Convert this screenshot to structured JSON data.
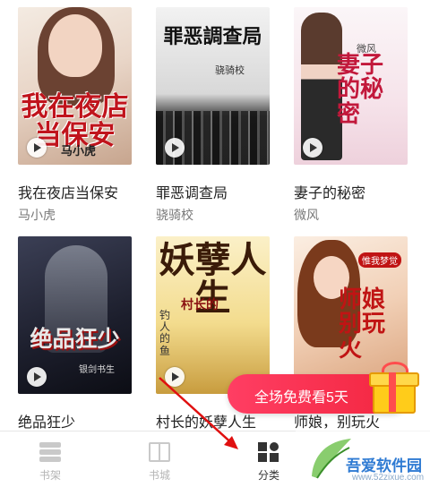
{
  "books": [
    {
      "title": "我在夜店当保安",
      "author": "马小虎",
      "cover_text": "我在夜店当保安",
      "cover_author": "马小虎"
    },
    {
      "title": "罪恶调查局",
      "author": "骁骑校",
      "cover_text": "罪恶調查局",
      "cover_author": "骁骑校"
    },
    {
      "title": "妻子的秘密",
      "author": "微风",
      "cover_text": "妻子的秘密",
      "cover_author": "微风"
    },
    {
      "title": "绝品狂少",
      "author": "",
      "cover_text": "绝品狂少",
      "cover_author": "银剑书生"
    },
    {
      "title": "村长的妖孽人生",
      "author": "",
      "cover_text": "妖孽人生",
      "cover_author": "村长的",
      "cover_author2": "钓人的鱼"
    },
    {
      "title": "师娘，别玩火",
      "author": "",
      "cover_text": "师娘别玩火",
      "cover_author": "惟我梦觉"
    }
  ],
  "promo": {
    "text": "全场免费看5天"
  },
  "tabs": [
    {
      "label": "书架",
      "icon": "bookshelf-icon"
    },
    {
      "label": "书城",
      "icon": "book-icon"
    },
    {
      "label": "分类",
      "icon": "category-icon",
      "active": true
    }
  ],
  "watermark": {
    "text": "吾爱软件园",
    "url": "www.52zixue.com"
  },
  "colors": {
    "promo": "#f2253e",
    "tab_inactive": "#b5b5b5",
    "tab_active": "#333333",
    "watermark": "#2f7bd3"
  }
}
